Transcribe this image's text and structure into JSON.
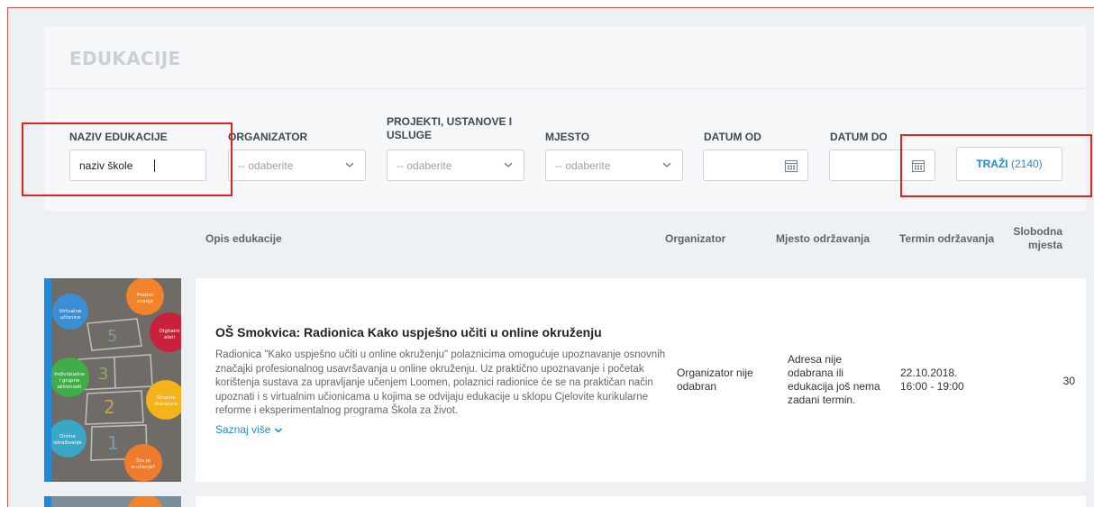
{
  "page_title": "EDUKACIJE",
  "filters": {
    "naziv": {
      "label": "NAZIV EDUKACIJE",
      "value": "naziv škole"
    },
    "organizator": {
      "label": "ORGANIZATOR",
      "placeholder": "-- odaberite"
    },
    "projekti": {
      "label_line1": "PROJEKTI, USTANOVE I",
      "label_line2": "USLUGE",
      "placeholder": "-- odaberite"
    },
    "mjesto": {
      "label": "MJESTO",
      "placeholder": "-- odaberite"
    },
    "datum_od": {
      "label": "DATUM OD"
    },
    "datum_do": {
      "label": "DATUM DO"
    },
    "search_button": {
      "label": "TRAŽI",
      "count": "(2140)"
    }
  },
  "table": {
    "headers": {
      "opis": "Opis edukacije",
      "organizator": "Organizator",
      "mjesto": "Mjesto održavanja",
      "termin": "Termin održavanja",
      "slobodna_line1": "Slobodna",
      "slobodna_line2": "mjesta"
    },
    "rows": [
      {
        "title": "OŠ Smokvica: Radionica Kako uspješno učiti u online okruženju",
        "description": "Radionica \"Kako uspješno učiti u online okruženju\" polaznicima omogućuje upoznavanje osnovnih značajki profesionalnog usavršavanja u online okruženju. Uz praktično upoznavanje i početak korištenja sustava za upravljanje učenjem Loomen, polaznici radionice će se na praktičan način upoznati i s virtualnim učionicama u kojima se odvijaju edukacije u sklopu Cjelovite kurikularne reforme i eksperimentalnog programa Škola za život.",
        "more_label": "Saznaj više",
        "organizator_line1": "Organizator nije",
        "organizator_line2": "odabran",
        "mjesto_line1": "Adresa nije",
        "mjesto_line2": "odabrana ili",
        "mjesto_line3": "edukacija još nema",
        "mjesto_line4": "zadani termin.",
        "termin_date": "22.10.2018.",
        "termin_time": "16:00 - 19:00",
        "slobodna": "30",
        "thumbnail_circles": [
          "Virtualne učionice",
          "Prostor znanja",
          "Digitalni alati",
          "Individualne i grupne aktivnosti",
          "Stručna literatura",
          "Online istraživanje",
          "Što je e-učenje?"
        ]
      }
    ]
  },
  "colors": {
    "accent": "#1f8bd8",
    "highlight": "#e2221f",
    "title": "#c9d0d6"
  }
}
